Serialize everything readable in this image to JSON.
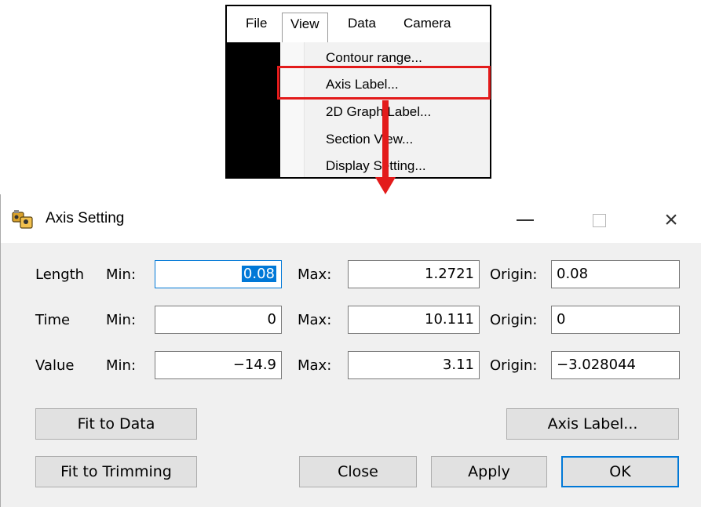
{
  "menu": {
    "menubar": [
      "File",
      "View",
      "Data",
      "Camera"
    ],
    "items": [
      "Contour range...",
      "Axis Label...",
      "2D Graph Label...",
      "Section View...",
      "Display Setting..."
    ],
    "highlighted": "Axis Label...",
    "highlight_color": "#e31b1b"
  },
  "dialog": {
    "title": "Axis Setting",
    "icon": "app-icon",
    "controls": {
      "minimize": "minimize-icon",
      "maximize": "maximize-icon",
      "close": "×"
    },
    "labels": {
      "min": "Min:",
      "max": "Max:",
      "origin": "Origin:"
    },
    "rows": [
      {
        "name": "Length",
        "min": "0.08",
        "max": "1.2721",
        "origin": "0.08"
      },
      {
        "name": "Time",
        "min": "0",
        "max": "10.111",
        "origin": "0"
      },
      {
        "name": "Value",
        "min": "−14.9",
        "max": "3.11",
        "origin": "−3.028044"
      }
    ],
    "buttons": {
      "fit_to_data": "Fit to Data",
      "fit_to_trimming": "Fit to Trimming",
      "axis_label": "Axis Label...",
      "close": "Close",
      "apply": "Apply",
      "ok": "OK"
    },
    "accent_color": "#0078d7"
  }
}
